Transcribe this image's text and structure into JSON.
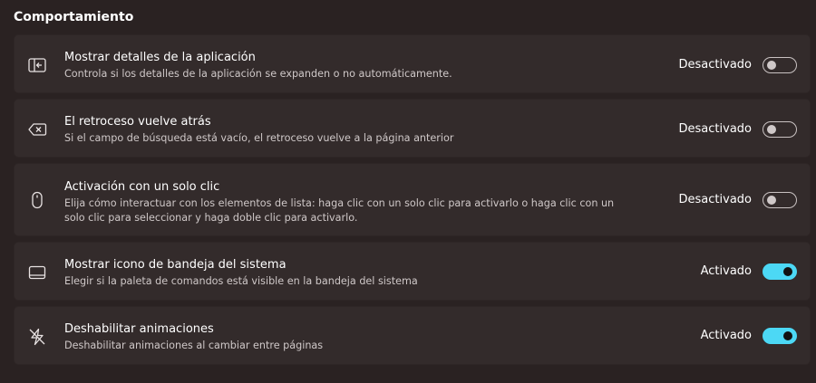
{
  "section": {
    "title": "Comportamiento"
  },
  "settings": [
    {
      "icon": "app-details-icon",
      "title": "Mostrar detalles de la aplicación",
      "description": "Controla si los detalles de la aplicación se expanden o no automáticamente.",
      "state_label": "Desactivado",
      "enabled": false
    },
    {
      "icon": "backspace-icon",
      "title": "El retroceso vuelve atrás",
      "description": "Si el campo de búsqueda está vacío, el retroceso vuelve a la página anterior",
      "state_label": "Desactivado",
      "enabled": false
    },
    {
      "icon": "mouse-icon",
      "title": "Activación con un solo clic",
      "description": "Elija cómo interactuar con los elementos de lista: haga clic con un solo clic para activarlo o haga clic con un solo clic para seleccionar y haga doble clic para activarlo.",
      "state_label": "Desactivado",
      "enabled": false
    },
    {
      "icon": "system-tray-icon",
      "title": "Mostrar icono de bandeja del sistema",
      "description": "Elegir si la paleta de comandos está visible en la bandeja del sistema",
      "state_label": "Activado",
      "enabled": true
    },
    {
      "icon": "lightning-icon",
      "title": "Deshabilitar animaciones",
      "description": "Deshabilitar animaciones al cambiar entre páginas",
      "state_label": "Activado",
      "enabled": true
    }
  ]
}
